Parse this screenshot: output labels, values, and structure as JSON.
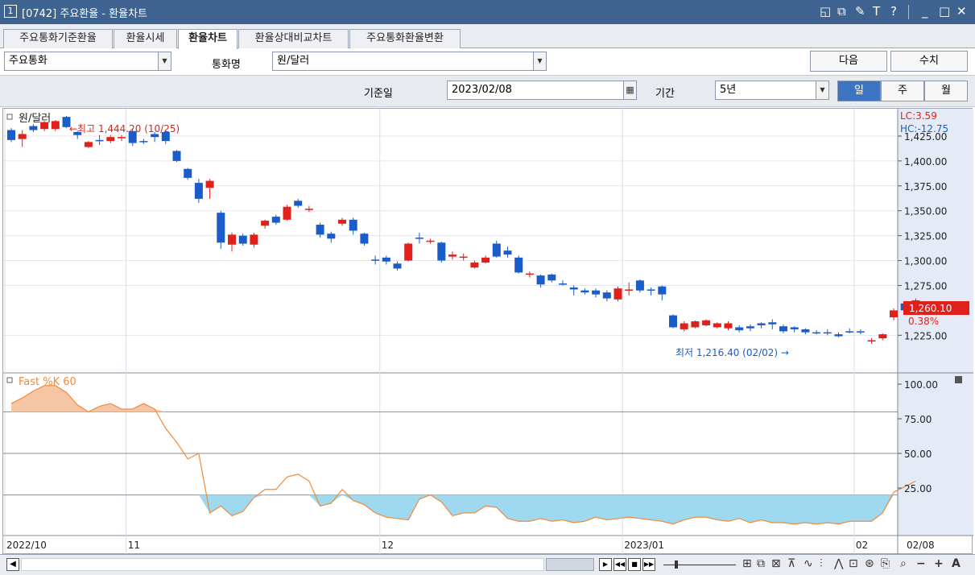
{
  "window": {
    "number": "1",
    "title": "[0742] 주요환율 - 환율차트",
    "icons": [
      "restore-icon",
      "popout-icon",
      "pin-icon",
      "font-icon",
      "help-icon",
      "minimize-icon",
      "maximize-icon",
      "close-icon"
    ],
    "icon_glyphs": [
      "◱",
      "⧉",
      "✎",
      "T",
      "?",
      "_",
      "□",
      "✕"
    ]
  },
  "tabs": [
    {
      "label": "주요통화기준환율",
      "active": false
    },
    {
      "label": "환율시세",
      "active": false
    },
    {
      "label": "환율차트",
      "active": true
    },
    {
      "label": "환율상대비교차트",
      "active": false
    },
    {
      "label": "주요통화환율변환",
      "active": false
    }
  ],
  "filters": {
    "category_value": "주요통화",
    "currency_label": "통화명",
    "currency_value": "원/달러",
    "next_label": "다음",
    "values_label": "수치"
  },
  "period": {
    "base_date_label": "기준일",
    "base_date_value": "2023/02/08",
    "range_label": "기간",
    "range_value": "5년",
    "periods": [
      {
        "label": "일",
        "active": true
      },
      {
        "label": "주",
        "active": false
      },
      {
        "label": "월",
        "active": false
      }
    ]
  },
  "chart": {
    "title": "원/달러",
    "high_annotation": "←최고 1,444.20 (10/25)",
    "low_annotation": "최저 1,216.40 (02/02) →",
    "lc": "LC:3.59",
    "hc": "HC:-12.75",
    "current_price": "1,260.10",
    "current_change": "0.38%",
    "oscillator_title": "Fast %K 60",
    "colors": {
      "up": "#e0201b",
      "down": "#1a5cc8",
      "stoch": "#f08a3a",
      "stoch_fill_high": "#f6c6a4",
      "stoch_fill_low": "#9ed9f0"
    }
  },
  "chart_data": {
    "type": "candlestick",
    "price_axis_ticks": [
      "1,425.00",
      "1,400.00",
      "1,375.00",
      "1,350.00",
      "1,325.00",
      "1,300.00",
      "1,275.00",
      "1,225.00"
    ],
    "ylim": [
      1200,
      1450
    ],
    "stoch_axis_ticks": [
      "100.00",
      "75.00",
      "50.00",
      "25.00"
    ],
    "stoch_ylim": [
      -3,
      105
    ],
    "x_ticks": [
      {
        "label": "2022/10",
        "index": 0
      },
      {
        "label": "11",
        "index": 11
      },
      {
        "label": "12",
        "index": 34
      },
      {
        "label": "2023/01",
        "index": 56
      },
      {
        "label": "02",
        "index": 77
      }
    ],
    "x_end_label": "02/08",
    "candles": [
      [
        1431,
        1421,
        1433,
        1419,
        "d"
      ],
      [
        1422,
        1427,
        1431,
        1414,
        "u"
      ],
      [
        1431,
        1435,
        1437,
        1429,
        "d"
      ],
      [
        1432,
        1439,
        1440,
        1430,
        "u"
      ],
      [
        1432,
        1440,
        1441,
        1430,
        "u"
      ],
      [
        1444.2,
        1434,
        1445,
        1433,
        "d"
      ],
      [
        1429,
        1426,
        1430,
        1422,
        "d"
      ],
      [
        1419,
        1414,
        1420,
        1413,
        "u"
      ],
      [
        1420,
        1421,
        1426,
        1416,
        "d"
      ],
      [
        1420,
        1424,
        1426,
        1418,
        "u"
      ],
      [
        1424,
        1424,
        1426,
        1420,
        "u"
      ],
      [
        1430,
        1418,
        1432,
        1415,
        "d"
      ],
      [
        1420,
        1419,
        1422,
        1417,
        "d"
      ],
      [
        1427,
        1424,
        1429,
        1419,
        "d"
      ],
      [
        1429,
        1420,
        1431,
        1417,
        "d"
      ],
      [
        1410,
        1400,
        1411,
        1399,
        "d"
      ],
      [
        1392,
        1383,
        1393,
        1381,
        "d"
      ],
      [
        1378,
        1362,
        1382,
        1358,
        "d"
      ],
      [
        1373,
        1380,
        1382,
        1362,
        "u"
      ],
      [
        1348,
        1318,
        1350,
        1312,
        "d"
      ],
      [
        1316,
        1326,
        1328,
        1309,
        "u"
      ],
      [
        1325,
        1317,
        1327,
        1315,
        "d"
      ],
      [
        1316,
        1326,
        1328,
        1313,
        "u"
      ],
      [
        1335,
        1340,
        1341,
        1332,
        "u"
      ],
      [
        1338,
        1344,
        1346,
        1336,
        "d"
      ],
      [
        1341,
        1354,
        1356,
        1340,
        "u"
      ],
      [
        1355,
        1360,
        1362,
        1353,
        "d"
      ],
      [
        1352,
        1352,
        1355,
        1349,
        "u"
      ],
      [
        1336,
        1326,
        1338,
        1323,
        "d"
      ],
      [
        1327,
        1322,
        1329,
        1318,
        "d"
      ],
      [
        1337,
        1341,
        1343,
        1335,
        "u"
      ],
      [
        1341,
        1330,
        1343,
        1326,
        "d"
      ],
      [
        1327,
        1317,
        1328,
        1315,
        "d"
      ],
      [
        1301,
        1300,
        1305,
        1296,
        "d"
      ],
      [
        1303,
        1299,
        1305,
        1296,
        "d"
      ],
      [
        1297,
        1292,
        1299,
        1290,
        "d"
      ],
      [
        1300,
        1317,
        1318,
        1299,
        "u"
      ],
      [
        1322,
        1323,
        1328,
        1317,
        "d"
      ],
      [
        1320,
        1319,
        1322,
        1317,
        "u"
      ],
      [
        1318,
        1300,
        1319,
        1298,
        "d"
      ],
      [
        1304,
        1306,
        1309,
        1301,
        "u"
      ],
      [
        1304,
        1303,
        1307,
        1300,
        "u"
      ],
      [
        1298,
        1293,
        1300,
        1292,
        "u"
      ],
      [
        1298,
        1303,
        1305,
        1297,
        "u"
      ],
      [
        1317,
        1304,
        1320,
        1303,
        "d"
      ],
      [
        1310,
        1306,
        1314,
        1303,
        "d"
      ],
      [
        1303,
        1288,
        1305,
        1287,
        "d"
      ],
      [
        1287,
        1287,
        1289,
        1283,
        "u"
      ],
      [
        1285,
        1276,
        1286,
        1273,
        "d"
      ],
      [
        1286,
        1280,
        1287,
        1278,
        "d"
      ],
      [
        1277,
        1277,
        1280,
        1275,
        "d"
      ],
      [
        1273,
        1271,
        1275,
        1265,
        "d"
      ],
      [
        1270,
        1268,
        1272,
        1266,
        "d"
      ],
      [
        1270,
        1266,
        1272,
        1263,
        "d"
      ],
      [
        1268,
        1262,
        1270,
        1259,
        "d"
      ],
      [
        1261,
        1272,
        1274,
        1259,
        "u"
      ],
      [
        1271,
        1271,
        1278,
        1265,
        "u"
      ],
      [
        1280,
        1270,
        1281,
        1268,
        "d"
      ],
      [
        1271,
        1270,
        1273,
        1265,
        "d"
      ],
      [
        1274,
        1266,
        1275,
        1260,
        "d"
      ],
      [
        1245,
        1233,
        1246,
        1232,
        "d"
      ],
      [
        1231,
        1237,
        1239,
        1229,
        "u"
      ],
      [
        1233,
        1239,
        1240,
        1232,
        "u"
      ],
      [
        1240,
        1235,
        1241,
        1234,
        "u"
      ],
      [
        1233,
        1237,
        1238,
        1232,
        "u"
      ],
      [
        1232,
        1237,
        1239,
        1230,
        "u"
      ],
      [
        1233,
        1230,
        1235,
        1228,
        "d"
      ],
      [
        1232,
        1234,
        1236,
        1229,
        "d"
      ],
      [
        1237,
        1235,
        1238,
        1232,
        "d"
      ],
      [
        1238,
        1236,
        1241,
        1231,
        "d"
      ],
      [
        1234,
        1229,
        1236,
        1227,
        "d"
      ],
      [
        1233,
        1231,
        1234,
        1228,
        "d"
      ],
      [
        1231,
        1228,
        1232,
        1226,
        "d"
      ],
      [
        1228,
        1228,
        1230,
        1226,
        "d"
      ],
      [
        1228,
        1228,
        1231,
        1225,
        "d"
      ],
      [
        1226,
        1224,
        1228,
        1223,
        "d"
      ],
      [
        1229,
        1229,
        1232,
        1227,
        "d"
      ],
      [
        1229,
        1229,
        1231,
        1226,
        "d"
      ],
      [
        1220,
        1220,
        1222,
        1216.4,
        "u"
      ],
      [
        1222,
        1226,
        1227,
        1220,
        "u"
      ],
      [
        1243,
        1250,
        1252,
        1240,
        "u"
      ],
      [
        1250,
        1257,
        1259,
        1248,
        "d"
      ],
      [
        1255,
        1260.1,
        1262,
        1249,
        "u"
      ]
    ],
    "stoch": [
      86,
      90,
      95,
      99,
      99,
      94,
      85,
      80,
      84,
      86,
      82,
      82,
      86,
      82,
      68,
      58,
      46,
      50,
      7,
      12,
      5,
      8,
      18,
      24,
      24,
      33,
      35,
      30,
      12,
      14,
      24,
      16,
      13,
      7,
      4,
      3,
      2,
      17,
      20,
      15,
      5,
      7,
      7,
      12,
      11,
      3,
      1,
      1,
      3,
      1,
      2,
      0,
      1,
      4,
      2,
      3,
      4,
      3,
      2,
      1,
      -1,
      2,
      4,
      4,
      2,
      1,
      3,
      0,
      2,
      0,
      0,
      -1,
      0,
      -1,
      0,
      -1,
      1,
      1,
      1,
      7,
      22,
      26,
      30
    ],
    "stoch_levels": [
      80,
      50,
      20
    ]
  },
  "bottom": {
    "toolbar_icons": [
      "play-icon",
      "rewind-icon",
      "stop-icon",
      "fast-forward-icon",
      "zoom-slider",
      "split-icon",
      "overlay-icon",
      "compare-icon",
      "trend-icon",
      "wave-icon",
      "candle-tool-icon",
      "magic-icon",
      "screenshot-icon",
      "search-icon",
      "zoom-out-icon",
      "zoom-in-icon",
      "font-size-icon"
    ]
  }
}
